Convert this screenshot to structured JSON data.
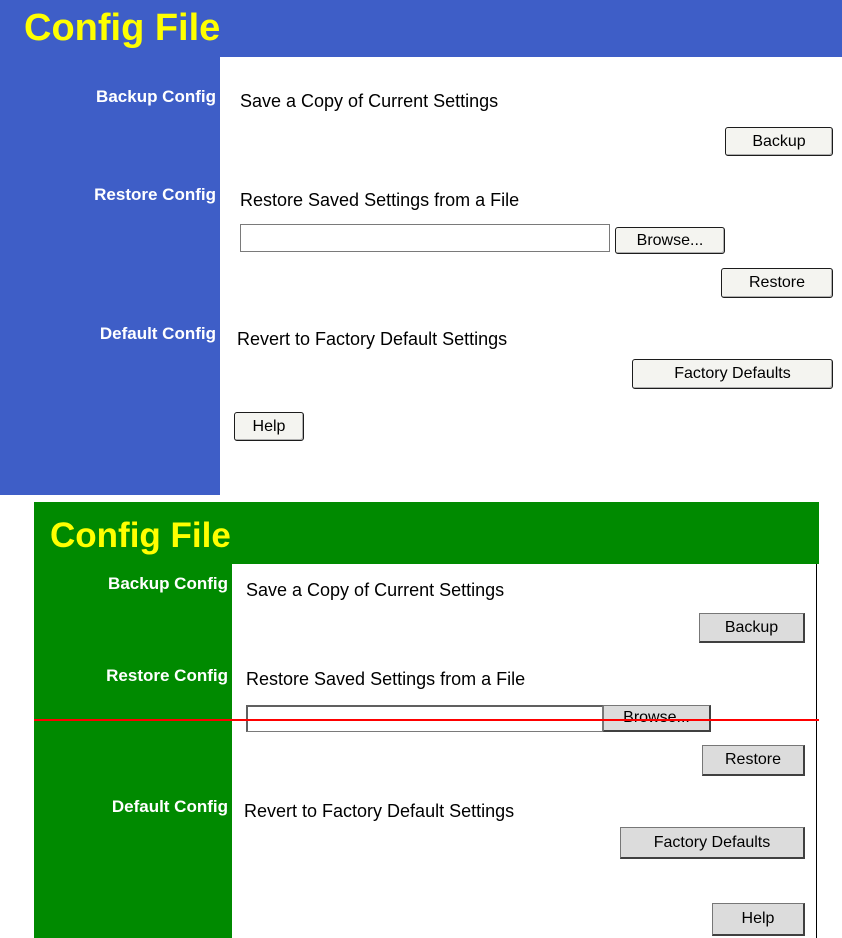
{
  "panels": [
    {
      "title": "Config File",
      "colors": {
        "header": "#3e5ec7",
        "sidebar": "#3e5ec7",
        "title_text": "#ffff00"
      },
      "backup": {
        "label": "Backup Config",
        "description": "Save a Copy of Current Settings",
        "button": "Backup"
      },
      "restore": {
        "label": "Restore Config",
        "description": "Restore Saved Settings from a File",
        "file_value": "",
        "browse_button": "Browse...",
        "button": "Restore"
      },
      "default": {
        "label": "Default Config",
        "description": "Revert to Factory Default Settings",
        "button": "Factory Defaults"
      },
      "help_button": "Help"
    },
    {
      "title": "Config File",
      "colors": {
        "header": "#008a00",
        "sidebar": "#008a00",
        "title_text": "#ffff00",
        "divider_line": "#ff0000"
      },
      "backup": {
        "label": "Backup Config",
        "description": "Save a Copy of Current Settings",
        "button": "Backup"
      },
      "restore": {
        "label": "Restore Config",
        "description": "Restore Saved Settings from a File",
        "file_value": "",
        "browse_button": "Browse...",
        "button": "Restore"
      },
      "default": {
        "label": "Default Config",
        "description": "Revert to Factory Default Settings",
        "button": "Factory Defaults"
      },
      "help_button": "Help"
    }
  ]
}
